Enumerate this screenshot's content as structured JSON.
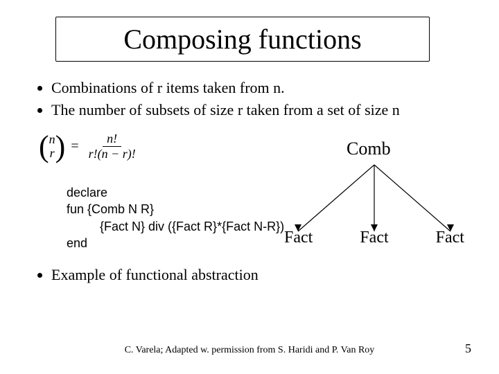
{
  "title": "Composing functions",
  "bullets": [
    "Combinations of r items taken from n.",
    "The number of subsets of size r taken from a set of size n"
  ],
  "formula": {
    "top": "n",
    "bottom": "r",
    "eq": "=",
    "num": "n!",
    "den": "r!(n − r)!"
  },
  "tree": {
    "root": "Comb",
    "leaves": [
      "Fact",
      "Fact",
      "Fact"
    ]
  },
  "code": {
    "l1": "declare",
    "l2": "fun {Comb N R}",
    "l3": "{Fact N} div ({Fact R}*{Fact N-R})",
    "l4": "end"
  },
  "abstraction": "Example of functional abstraction",
  "footer": "C. Varela;  Adapted w. permission from S. Haridi and P. Van Roy",
  "page": "5"
}
